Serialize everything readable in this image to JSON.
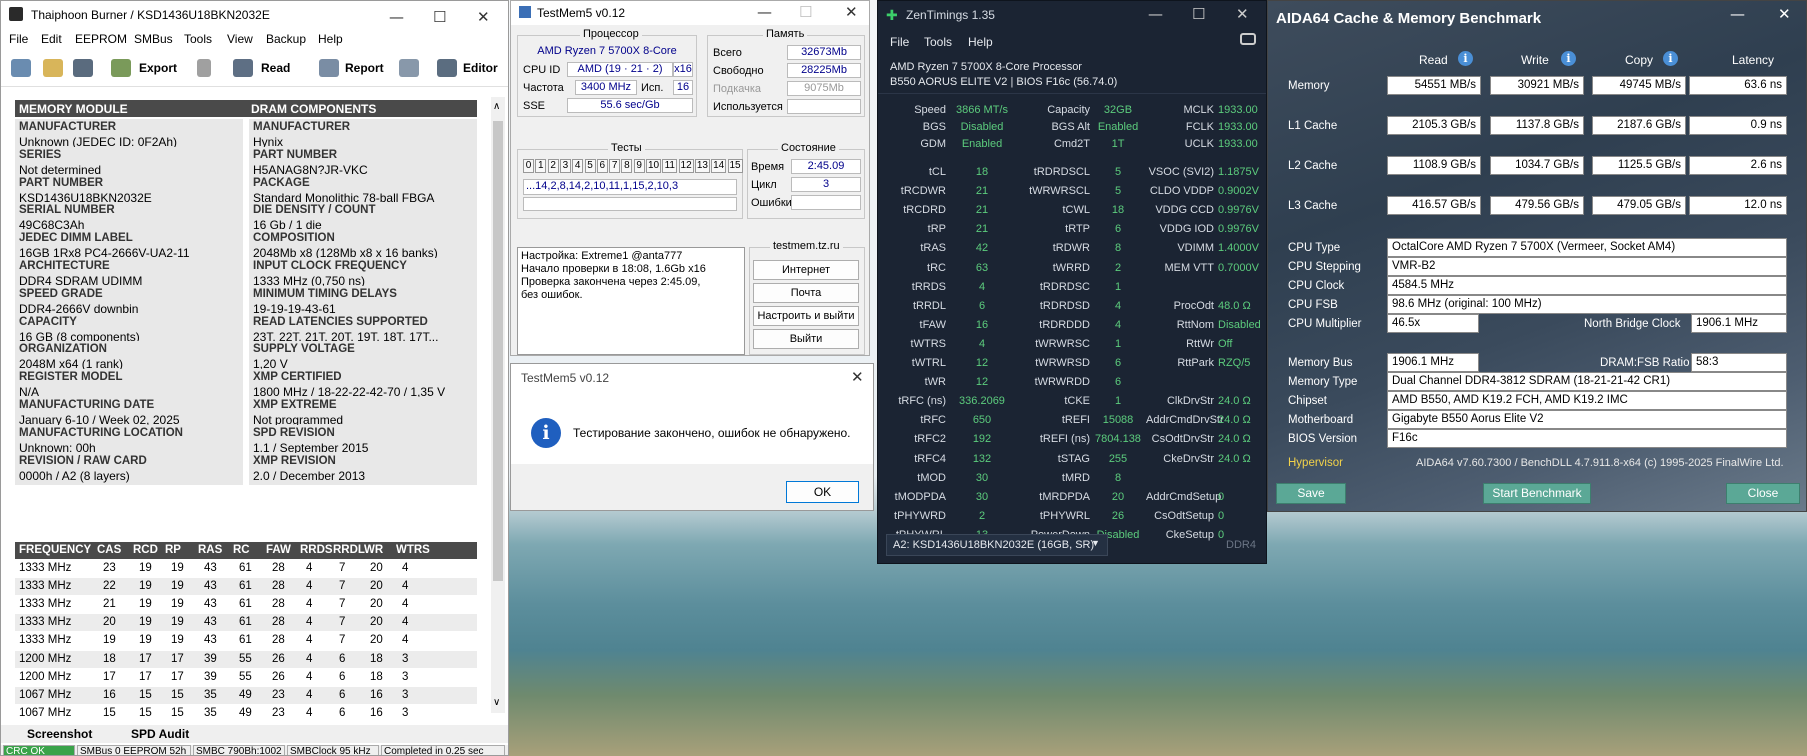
{
  "thaiphoon": {
    "title": "Thaiphoon Burner / KSD1436U18BKN2032E",
    "menu": [
      "File",
      "Edit",
      "EEPROM",
      "SMBus",
      "Tools",
      "View",
      "Backup",
      "Help"
    ],
    "toolbar": {
      "export": "Export",
      "read": "Read",
      "report": "Report",
      "editor": "Editor"
    },
    "headers": {
      "left": "MEMORY MODULE",
      "right": "DRAM COMPONENTS"
    },
    "rows": [
      {
        "l_label": "MANUFACTURER",
        "l_value": "Unknown (JEDEC ID: 0F2Ah)",
        "r_label": "MANUFACTURER",
        "r_value": "Hynix"
      },
      {
        "l_label": "SERIES",
        "l_value": "Not determined",
        "r_label": "PART NUMBER",
        "r_value": "H5ANAG8N?JR-VKC"
      },
      {
        "l_label": "PART NUMBER",
        "l_value": "KSD1436U18BKN2032E",
        "r_label": "PACKAGE",
        "r_value": "Standard Monolithic 78-ball FBGA"
      },
      {
        "l_label": "SERIAL NUMBER",
        "l_value": "49C68C3Ah",
        "r_label": "DIE DENSITY / COUNT",
        "r_value": "16 Gb / 1 die"
      },
      {
        "l_label": "JEDEC DIMM LABEL",
        "l_value": "16GB 1Rx8 PC4-2666V-UA2-11",
        "r_label": "COMPOSITION",
        "r_value": "2048Mb x8 (128Mb x8 x 16 banks)"
      },
      {
        "l_label": "ARCHITECTURE",
        "l_value": "DDR4 SDRAM UDIMM",
        "r_label": "INPUT CLOCK FREQUENCY",
        "r_value": "1333 MHz (0,750 ns)"
      },
      {
        "l_label": "SPEED GRADE",
        "l_value": "DDR4-2666V downbin",
        "r_label": "MINIMUM TIMING DELAYS",
        "r_value": "19-19-19-43-61"
      },
      {
        "l_label": "CAPACITY",
        "l_value": "16 GB (8 components)",
        "r_label": "READ LATENCIES SUPPORTED",
        "r_value": "23T, 22T, 21T, 20T, 19T, 18T, 17T..."
      },
      {
        "l_label": "ORGANIZATION",
        "l_value": "2048M x64 (1 rank)",
        "r_label": "SUPPLY VOLTAGE",
        "r_value": "1,20 V"
      },
      {
        "l_label": "REGISTER MODEL",
        "l_value": "N/A",
        "r_label": "XMP CERTIFIED",
        "r_value": "1800 MHz / 18-22-22-42-70 / 1,35 V"
      },
      {
        "l_label": "MANUFACTURING DATE",
        "l_value": "January 6-10 / Week 02, 2025",
        "r_label": "XMP EXTREME",
        "r_value": "Not programmed"
      },
      {
        "l_label": "MANUFACTURING LOCATION",
        "l_value": "Unknown: 00h",
        "r_label": "SPD REVISION",
        "r_value": "1.1 / September 2015"
      },
      {
        "l_label": "REVISION / RAW CARD",
        "l_value": "0000h / A2 (8 layers)",
        "r_label": "XMP REVISION",
        "r_value": "2.0 / December 2013"
      }
    ],
    "freq_headers": [
      "FREQUENCY",
      "CAS",
      "RCD",
      "RP",
      "RAS",
      "RC",
      "FAW",
      "RRDS",
      "RRDL",
      "WR",
      "WTRS"
    ],
    "freq_rows": [
      [
        "1333 MHz",
        "23",
        "19",
        "19",
        "43",
        "61",
        "28",
        "4",
        "7",
        "20",
        "4"
      ],
      [
        "1333 MHz",
        "22",
        "19",
        "19",
        "43",
        "61",
        "28",
        "4",
        "7",
        "20",
        "4"
      ],
      [
        "1333 MHz",
        "21",
        "19",
        "19",
        "43",
        "61",
        "28",
        "4",
        "7",
        "20",
        "4"
      ],
      [
        "1333 MHz",
        "20",
        "19",
        "19",
        "43",
        "61",
        "28",
        "4",
        "7",
        "20",
        "4"
      ],
      [
        "1333 MHz",
        "19",
        "19",
        "19",
        "43",
        "61",
        "28",
        "4",
        "7",
        "20",
        "4"
      ],
      [
        "1200 MHz",
        "18",
        "17",
        "17",
        "39",
        "55",
        "26",
        "4",
        "6",
        "18",
        "3"
      ],
      [
        "1200 MHz",
        "17",
        "17",
        "17",
        "39",
        "55",
        "26",
        "4",
        "6",
        "18",
        "3"
      ],
      [
        "1067 MHz",
        "16",
        "15",
        "15",
        "35",
        "49",
        "23",
        "4",
        "6",
        "16",
        "3"
      ],
      [
        "1067 MHz",
        "15",
        "15",
        "15",
        "35",
        "49",
        "23",
        "4",
        "6",
        "16",
        "3"
      ]
    ],
    "tabs": [
      "Screenshot",
      "SPD Audit"
    ],
    "status": [
      "CRC OK",
      "SMBus 0 EEPROM 52h",
      "SMBC 790Bh:1002",
      "SMBClock 95 kHz",
      "Completed in 0.25 sec"
    ]
  },
  "testmem": {
    "title": "TestMem5 v0.12",
    "cpu_group": "Процессор",
    "cpu_name": "AMD Ryzen 7 5700X 8-Core",
    "cpu_id_label": "CPU ID",
    "cpu_id": "AMD  (19 · 21 · 2)",
    "cpu_threads": "x16",
    "freq_label": "Частота",
    "freq": "3400 MHz",
    "used_label": "Исп.",
    "used": "16",
    "sse_label": "SSE",
    "sse": "55.6 sec/Gb",
    "mem_group": "Память",
    "total_label": "Всего",
    "total": "32673Mb",
    "free_label": "Свободно",
    "free": "28225Mb",
    "swap_label": "Подкачка",
    "swap": "9075Mb",
    "inuse_label": "Используется",
    "tests_group": "Тесты",
    "test_nums": [
      "0",
      "1",
      "2",
      "3",
      "4",
      "5",
      "6",
      "7",
      "8",
      "9",
      "10",
      "11",
      "12",
      "13",
      "14",
      "15"
    ],
    "test_seq": "...14,2,8,14,2,10,11,1,15,2,10,3",
    "state_group": "Состояние",
    "time_label": "Время",
    "time": "2:45.09",
    "cycle_label": "Цикл",
    "cycle": "3",
    "errors_label": "Ошибки",
    "log": [
      "Настройка: Extreme1 @anta777",
      "Начало проверки в 18:08, 1.6Gb x16",
      "Проверка закончена через 2:45.09,",
      "без ошибок."
    ],
    "site": "testmem.tz.ru",
    "buttons": [
      "Интернет",
      "Почта",
      "Настроить и выйти",
      "Выйти"
    ]
  },
  "dialog": {
    "title": "TestMem5 v0.12",
    "message": "Тестирование закончено, ошибок не обнаружено.",
    "ok": "OK"
  },
  "zen": {
    "title": "ZenTimings 1.35",
    "menu": [
      "File",
      "Tools",
      "Help"
    ],
    "cpu": "AMD Ryzen 7 5700X 8-Core Processor",
    "board": "B550 AORUS ELITE V2 | BIOS F16c (56.74.0)",
    "top": [
      [
        "Speed",
        "3866 MT/s",
        "Capacity",
        "32GB",
        "MCLK",
        "1933.00"
      ],
      [
        "BGS",
        "Disabled",
        "BGS Alt",
        "Enabled",
        "FCLK",
        "1933.00"
      ],
      [
        "GDM",
        "Enabled",
        "Cmd2T",
        "1T",
        "UCLK",
        "1933.00"
      ]
    ],
    "rows": [
      [
        "tCL",
        "18",
        "tRDRDSCL",
        "5",
        "VSOC (SVI2)",
        "1.1875V"
      ],
      [
        "tRCDWR",
        "21",
        "tWRWRSCL",
        "5",
        "CLDO VDDP",
        "0.9002V"
      ],
      [
        "tRCDRD",
        "21",
        "tCWL",
        "18",
        "VDDG CCD",
        "0.9976V"
      ],
      [
        "tRP",
        "21",
        "tRTP",
        "6",
        "VDDG IOD",
        "0.9976V"
      ],
      [
        "tRAS",
        "42",
        "tRDWR",
        "8",
        "VDIMM",
        "1.4000V"
      ],
      [
        "tRC",
        "63",
        "tWRRD",
        "2",
        "MEM VTT",
        "0.7000V"
      ],
      [
        "tRRDS",
        "4",
        "tRDRDSC",
        "1",
        "",
        ""
      ],
      [
        "tRRDL",
        "6",
        "tRDRDSD",
        "4",
        "ProcOdt",
        "48.0 Ω"
      ],
      [
        "tFAW",
        "16",
        "tRDRDDD",
        "4",
        "RttNom",
        "Disabled"
      ],
      [
        "tWTRS",
        "4",
        "tWRWRSC",
        "1",
        "RttWr",
        "Off"
      ],
      [
        "tWTRL",
        "12",
        "tWRWRSD",
        "6",
        "RttPark",
        "RZQ/5"
      ],
      [
        "tWR",
        "12",
        "tWRWRDD",
        "6",
        "",
        ""
      ],
      [
        "tRFC (ns)",
        "336.2069",
        "tCKE",
        "1",
        "ClkDrvStr",
        "24.0 Ω"
      ],
      [
        "tRFC",
        "650",
        "tREFI",
        "15088",
        "AddrCmdDrvStr",
        "24.0 Ω"
      ],
      [
        "tRFC2",
        "192",
        "tREFI (ns)",
        "7804.138",
        "CsOdtDrvStr",
        "24.0 Ω"
      ],
      [
        "tRFC4",
        "132",
        "tSTAG",
        "255",
        "CkeDrvStr",
        "24.0 Ω"
      ],
      [
        "tMOD",
        "30",
        "tMRD",
        "8",
        "",
        ""
      ],
      [
        "tMODPDA",
        "30",
        "tMRDPDA",
        "20",
        "AddrCmdSetup",
        "0"
      ],
      [
        "tPHYWRD",
        "2",
        "tPHYWRL",
        "26",
        "CsOdtSetup",
        "0"
      ],
      [
        "tPHYWRL",
        "13",
        "PowerDown",
        "Disabled",
        "CkeSetup",
        "0"
      ]
    ],
    "module": "A2: KSD1436U18BKN2032E (16GB, SR)",
    "ddr": "DDR4"
  },
  "aida": {
    "title": "AIDA64 Cache & Memory Benchmark",
    "cols": [
      "Read",
      "Write",
      "Copy",
      "Latency"
    ],
    "bench": [
      [
        "Memory",
        "54551 MB/s",
        "30921 MB/s",
        "49745 MB/s",
        "63.6 ns"
      ],
      [
        "L1 Cache",
        "2105.3 GB/s",
        "1137.8 GB/s",
        "2187.6 GB/s",
        "0.9 ns"
      ],
      [
        "L2 Cache",
        "1108.9 GB/s",
        "1034.7 GB/s",
        "1125.5 GB/s",
        "2.6 ns"
      ],
      [
        "L3 Cache",
        "416.57 GB/s",
        "479.56 GB/s",
        "479.05 GB/s",
        "12.0 ns"
      ]
    ],
    "cpu_type_label": "CPU Type",
    "cpu_type": "OctalCore AMD Ryzen 7 5700X  (Vermeer, Socket AM4)",
    "cpu_step_label": "CPU Stepping",
    "cpu_step": "VMR-B2",
    "cpu_clock_label": "CPU Clock",
    "cpu_clock": "4584.5 MHz",
    "cpu_fsb_label": "CPU FSB",
    "cpu_fsb": "98.6 MHz  (original: 100 MHz)",
    "cpu_mult_label": "CPU Multiplier",
    "cpu_mult": "46.5x",
    "nb_label": "North Bridge Clock",
    "nb": "1906.1 MHz",
    "mem_bus_label": "Memory Bus",
    "mem_bus": "1906.1 MHz",
    "ratio_label": "DRAM:FSB Ratio",
    "ratio": "58:3",
    "mem_type_label": "Memory Type",
    "mem_type": "Dual Channel DDR4-3812 SDRAM  (18-21-21-42 CR1)",
    "chipset_label": "Chipset",
    "chipset": "AMD B550, AMD K19.2 FCH, AMD K19.2 IMC",
    "mobo_label": "Motherboard",
    "mobo": "Gigabyte B550 Aorus Elite V2",
    "bios_label": "BIOS Version",
    "bios": "F16c",
    "hypervisor": "Hypervisor",
    "footer": "AIDA64 v7.60.7300 / BenchDLL 4.7.911.8-x64  (c) 1995-2025 FinalWire Ltd.",
    "buttons": [
      "Save",
      "Start Benchmark",
      "Close"
    ]
  }
}
